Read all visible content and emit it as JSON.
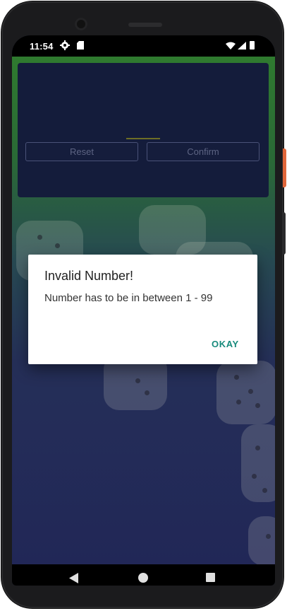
{
  "status_bar": {
    "time": "11:54",
    "icons": [
      "gear-icon",
      "sd-card-icon",
      "wifi-icon",
      "signal-icon",
      "battery-icon"
    ]
  },
  "app": {
    "reset_label": "Reset",
    "confirm_label": "Confirm"
  },
  "dialog": {
    "title": "Invalid Number!",
    "message": "Number has to be in between 1 - 99",
    "ok_label": "OKAY"
  },
  "nav_bar": {
    "icons": [
      "back-icon",
      "home-icon",
      "recents-icon"
    ]
  },
  "colors": {
    "accent": "#178a7c",
    "panel": "#141c3b",
    "background_top": "#2f7a2f",
    "background_bottom": "#212757"
  }
}
